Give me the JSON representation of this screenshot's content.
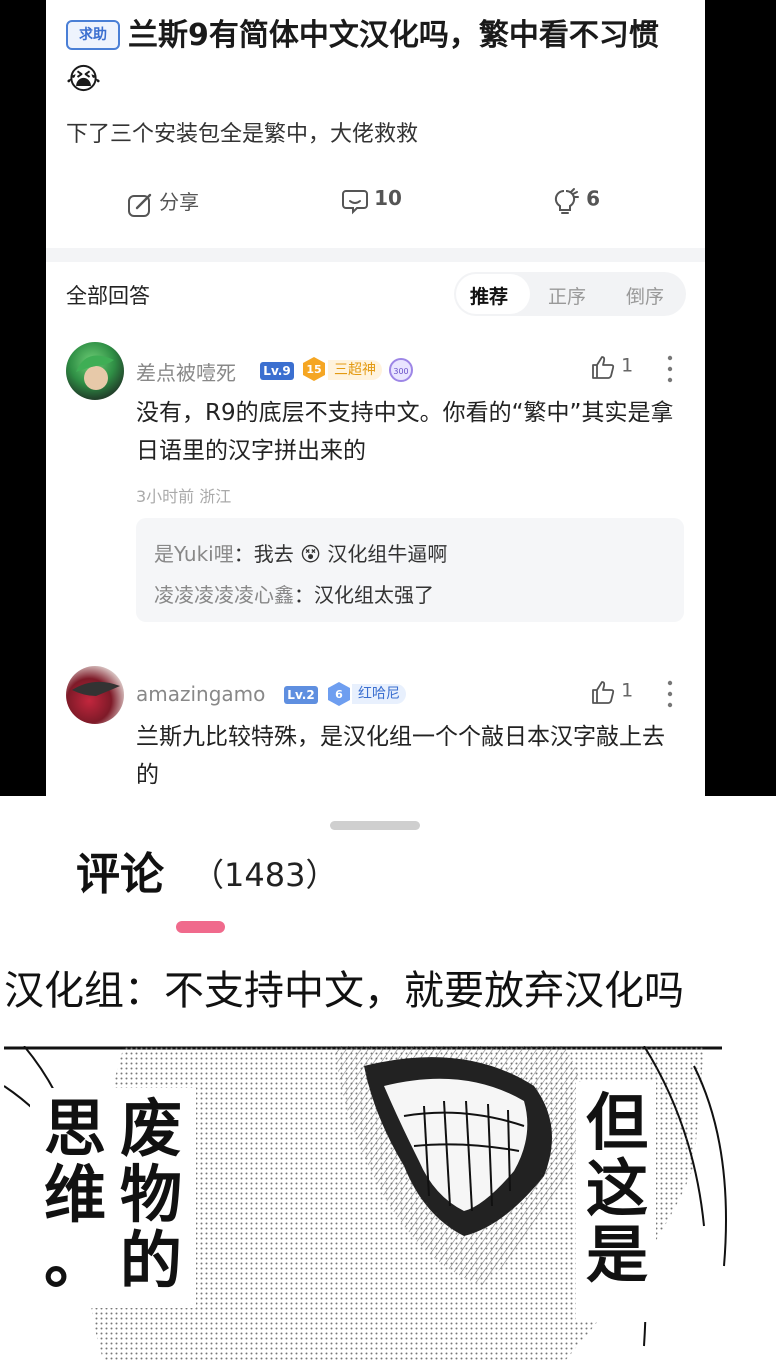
{
  "post": {
    "tag": "求助",
    "title": "兰斯9有简体中文汉化吗，繁中看不习惯😭",
    "body": "下了三个安装包全是繁中，大佬救救",
    "actions": [
      {
        "icon": "share-icon",
        "label": "分享"
      },
      {
        "icon": "comment-icon",
        "label": "10"
      },
      {
        "icon": "lightbulb-icon",
        "label": "6"
      }
    ]
  },
  "answers_header": {
    "title": "全部回答",
    "sort_tabs": [
      "推荐",
      "正序",
      "倒序"
    ],
    "active_sort": "推荐"
  },
  "answers": [
    {
      "username": "差点被噎死",
      "level": "Lv.9",
      "badge_num": "15",
      "badge_title": "三超神",
      "extra_badge": "300",
      "likes": "1",
      "text": "没有，R9的底层不支持中文。你看的“繁中”其实是拿日语里的汉字拼出来的",
      "time": "3小时前 浙江",
      "replies": [
        {
          "user": "是Yuki哩",
          "text": "我去 😵 汉化组牛逼啊"
        },
        {
          "user": "凌凌凌凌凌心鑫",
          "text": "汉化组太强了"
        }
      ]
    },
    {
      "username": "amazingamo",
      "level": "Lv.2",
      "badge_num": "6",
      "badge_title": "红哈尼",
      "likes": "1",
      "text": "兰斯九比较特殊，是汉化组一个个敲日本汉字敲上去的"
    }
  ],
  "comments_section": {
    "title": "评论",
    "count": "（1483）"
  },
  "caption": "汉化组：不支持中文，就要放弃汉化吗",
  "manga": {
    "col_left": "思维。",
    "col_mid": "废物的",
    "col_right": "但这是"
  },
  "colors": {
    "accent_blue": "#3b6fd0",
    "badge_gold": "#f5a623",
    "pink": "#f06a8c"
  }
}
